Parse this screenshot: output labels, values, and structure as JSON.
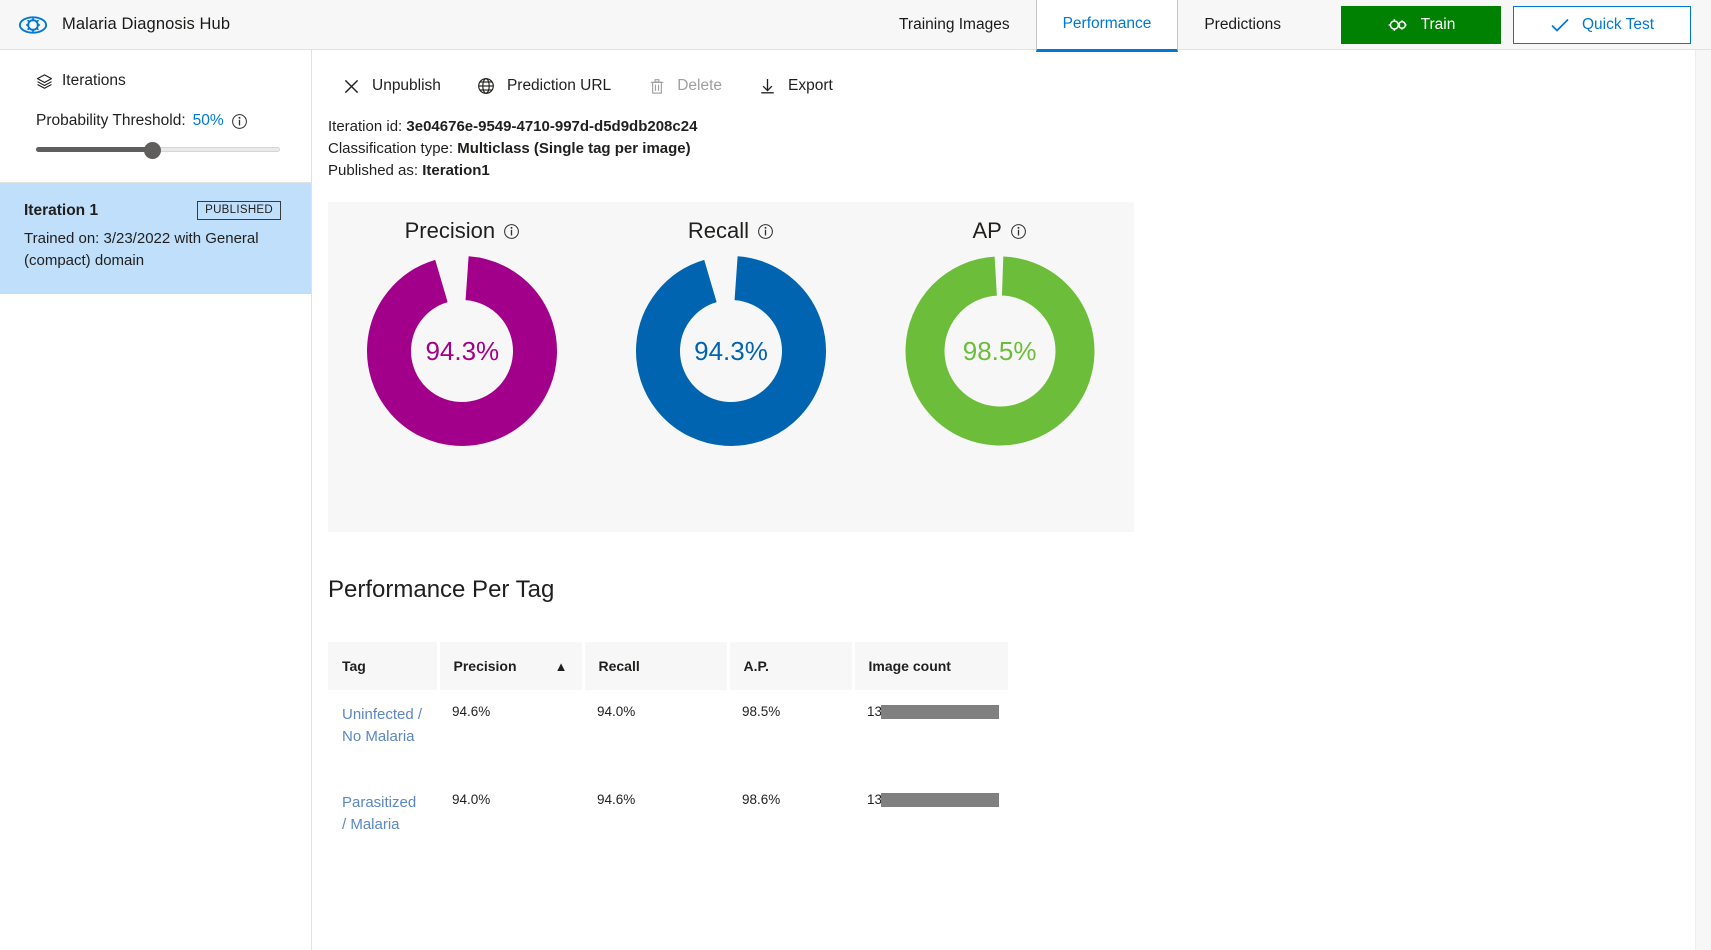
{
  "app": {
    "title": "Malaria Diagnosis Hub",
    "logo_icon": "eye-gear-icon"
  },
  "topnav": {
    "tabs": [
      {
        "label": "Training Images",
        "active": false
      },
      {
        "label": "Performance",
        "active": true
      },
      {
        "label": "Predictions",
        "active": false
      }
    ],
    "train_button": {
      "label": "Train",
      "icon": "gears-icon",
      "color": "#018101"
    },
    "quick_test_button": {
      "label": "Quick Test",
      "icon": "check-icon",
      "color": "#0078d4"
    }
  },
  "sidebar": {
    "header": {
      "label": "Iterations",
      "icon": "layers-icon"
    },
    "threshold": {
      "label_prefix": "Probability Threshold:",
      "value": "50%",
      "info_icon": "info-icon",
      "percent": 50
    },
    "iteration": {
      "name": "Iteration 1",
      "badge": "PUBLISHED",
      "subtitle": "Trained on: 3/23/2022 with General (compact) domain",
      "selected": true
    }
  },
  "commandbar": [
    {
      "label": "Unpublish",
      "icon": "close-icon",
      "disabled": false
    },
    {
      "label": "Prediction URL",
      "icon": "globe-icon",
      "disabled": false
    },
    {
      "label": "Delete",
      "icon": "trash-icon",
      "disabled": true
    },
    {
      "label": "Export",
      "icon": "download-icon",
      "disabled": false
    }
  ],
  "meta": {
    "iteration_id_label": "Iteration id:",
    "iteration_id_value": "3e04676e-9549-4710-997d-d5d9db208c24",
    "classification_type_label": "Classification type:",
    "classification_type_value": "Multiclass (Single tag per image)",
    "published_as_label": "Published as:",
    "published_as_value": "Iteration1"
  },
  "chart_data": [
    {
      "type": "pie",
      "title": "Precision",
      "info_icon": "info-icon",
      "value_label": "94.3%",
      "value": 94.3,
      "remainder": 5.7,
      "color": "#a2008a",
      "track_color": "#f7f7f7"
    },
    {
      "type": "pie",
      "title": "Recall",
      "info_icon": "info-icon",
      "value_label": "94.3%",
      "value": 94.3,
      "remainder": 5.7,
      "color": "#0064b0",
      "track_color": "#f7f7f7"
    },
    {
      "type": "pie",
      "title": "AP",
      "info_icon": "info-icon",
      "value_label": "98.5%",
      "value": 98.5,
      "remainder": 1.5,
      "color": "#6cbe3a",
      "track_color": "#f7f7f7"
    }
  ],
  "per_tag": {
    "section_title": "Performance Per Tag",
    "columns": [
      {
        "label": "Tag",
        "sorted": false
      },
      {
        "label": "Precision",
        "sorted": true,
        "sort_icon": "chevron-up-icon"
      },
      {
        "label": "Recall",
        "sorted": false
      },
      {
        "label": "A.P.",
        "sorted": false
      },
      {
        "label": "Image count",
        "sorted": false
      }
    ],
    "rows": [
      {
        "tag": "Uninfected / No Malaria",
        "precision": "94.6%",
        "recall": "94.0%",
        "ap": "98.5%",
        "image_count": "13779"
      },
      {
        "tag": "Parasitized / Malaria",
        "precision": "94.0%",
        "recall": "94.6%",
        "ap": "98.6%",
        "image_count": "13779"
      }
    ]
  }
}
